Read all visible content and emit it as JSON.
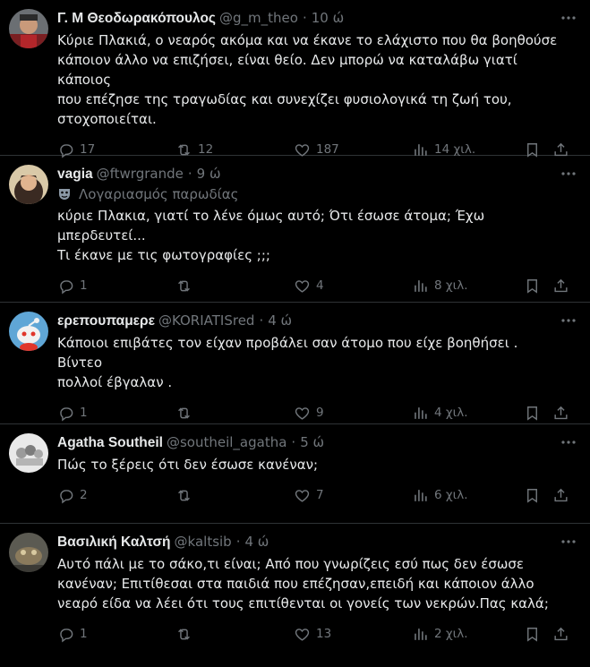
{
  "tweets": [
    {
      "name": "Γ. Μ Θεοδωρακόπουλος",
      "handle": "@g_m_theo",
      "time": "10 ώ",
      "parody": "",
      "text": "Κύριε Πλακιά, ο νεαρός ακόμα και να έκανε το ελάχιστο που θα βοηθούσε\nκάποιον άλλο να επιζήσει, είναι θείο. Δεν μπορώ να καταλάβω γιατί κάποιος\nπου επέζησε της τραγωδίας και συνεχίζει φυσιολογικά τη ζωή του,\nστοχοποιείται.",
      "replies": "17",
      "retweets": "12",
      "likes": "187",
      "views": "14 χιλ."
    },
    {
      "name": "vagia",
      "handle": "@ftwrgrande",
      "time": "9 ώ",
      "parody": "Λογαριασμός παρωδίας",
      "text": "κύριε Πλακια, γιατί το λένε όμως αυτό; Ότι έσωσε άτομα; Έχω μπερδευτεί...\nΤι έκανε με τις φωτογραφίες ;;;",
      "replies": "1",
      "retweets": "",
      "likes": "4",
      "views": "8 χιλ."
    },
    {
      "name": "ερεπουπαμερε",
      "handle": "@KORIATISred",
      "time": "4 ώ",
      "parody": "",
      "text": "Κάποιοι επιβάτες τον είχαν προβάλει σαν άτομο που είχε βοηθήσει . Βίντεο\nπολλοί έβγαλαν .",
      "replies": "1",
      "retweets": "",
      "likes": "9",
      "views": "4 χιλ."
    },
    {
      "name": "Agatha Southeil",
      "handle": "@southeil_agatha",
      "time": "5 ώ",
      "parody": "",
      "text": "Πώς το ξέρεις ότι δεν έσωσε κανέναν;",
      "replies": "2",
      "retweets": "",
      "likes": "7",
      "views": "6 χιλ."
    },
    {
      "name": "Βασιλική Καλτσή",
      "handle": "@kaltsib",
      "time": "4 ώ",
      "parody": "",
      "text": "Αυτό πάλι με το σάκο,τι είναι; Από που γνωρίζεις εσύ πως δεν έσωσε\nκανέναν; Επιτίθεσαι στα παιδιά που επέζησαν,επειδή και κάποιον άλλο\nνεαρό είδα να λέει ότι τους επιτίθενται οι γονείς των νεκρών.Πας καλά;",
      "replies": "1",
      "retweets": "",
      "likes": "13",
      "views": "2 χιλ."
    }
  ],
  "icons": {
    "reply": "reply-icon",
    "retweet": "retweet-icon",
    "like": "like-icon",
    "views": "views-icon",
    "bookmark": "bookmark-icon",
    "share": "share-icon",
    "more": "more-icon",
    "parody": "parody-mask-icon"
  },
  "colors": {
    "background": "#000000",
    "text": "#e7e9ea",
    "muted": "#71767b",
    "divider": "#2f3336"
  }
}
